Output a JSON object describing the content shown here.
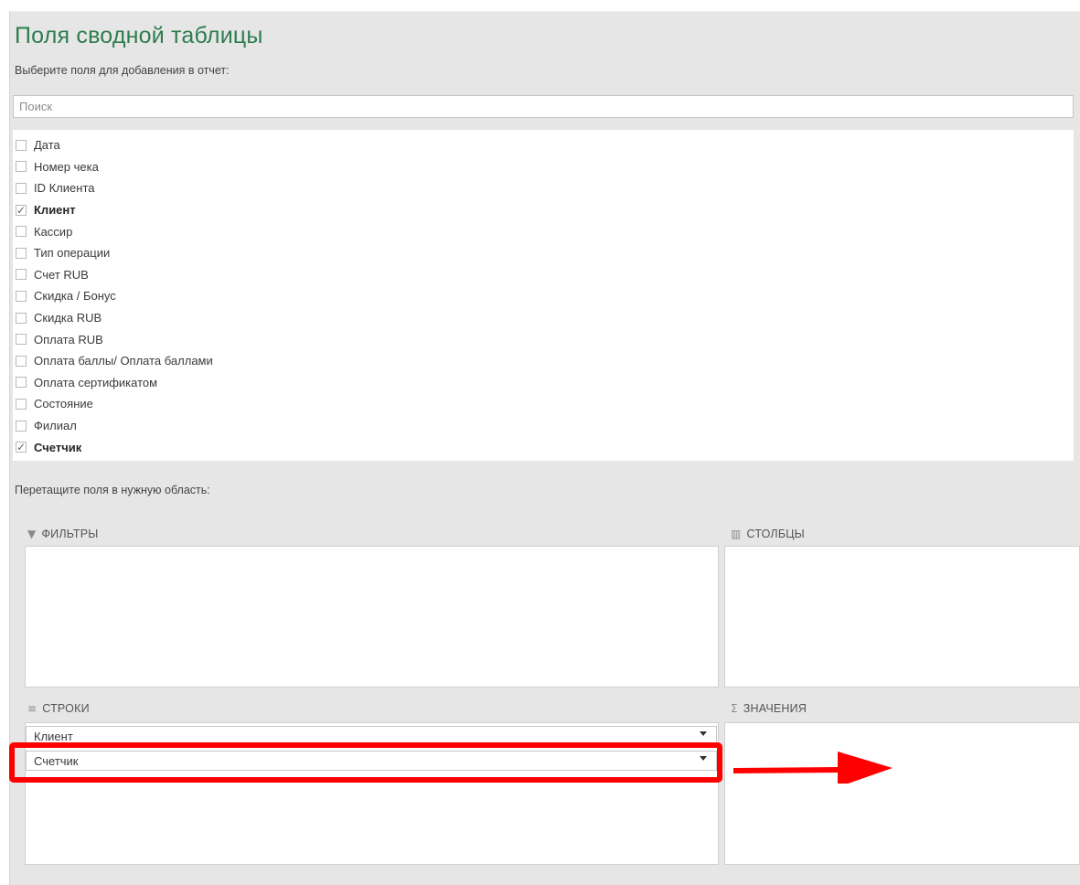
{
  "panel": {
    "title": "Поля сводной таблицы",
    "subtitle": "Выберите поля для добавления в отчет:",
    "search_placeholder": "Поиск"
  },
  "fields": [
    {
      "label": "Дата",
      "checked": false
    },
    {
      "label": "Номер чека",
      "checked": false
    },
    {
      "label": "ID Клиента",
      "checked": false
    },
    {
      "label": "Клиент",
      "checked": true
    },
    {
      "label": "Кассир",
      "checked": false
    },
    {
      "label": "Тип операции",
      "checked": false
    },
    {
      "label": "Счет RUB",
      "checked": false
    },
    {
      "label": "Скидка / Бонус",
      "checked": false
    },
    {
      "label": "Скидка RUB",
      "checked": false
    },
    {
      "label": "Оплата RUB",
      "checked": false
    },
    {
      "label": "Оплата баллы/ Оплата баллами",
      "checked": false
    },
    {
      "label": "Оплата сертификатом",
      "checked": false
    },
    {
      "label": "Состояние",
      "checked": false
    },
    {
      "label": "Филиал",
      "checked": false
    },
    {
      "label": "Счетчик",
      "checked": true
    }
  ],
  "areas": {
    "drag_hint": "Перетащите поля в нужную область:",
    "filters": {
      "label": "ФИЛЬТРЫ",
      "icon": "filter-icon"
    },
    "columns": {
      "label": "СТОЛБЦЫ",
      "icon": "columns-icon"
    },
    "rows": {
      "label": "СТРОКИ",
      "icon": "rows-icon",
      "items": [
        "Клиент",
        "Счетчик"
      ]
    },
    "values": {
      "label": "ЗНАЧЕНИЯ",
      "icon": "sigma-icon"
    }
  },
  "annotation": {
    "color": "#ff0000"
  }
}
